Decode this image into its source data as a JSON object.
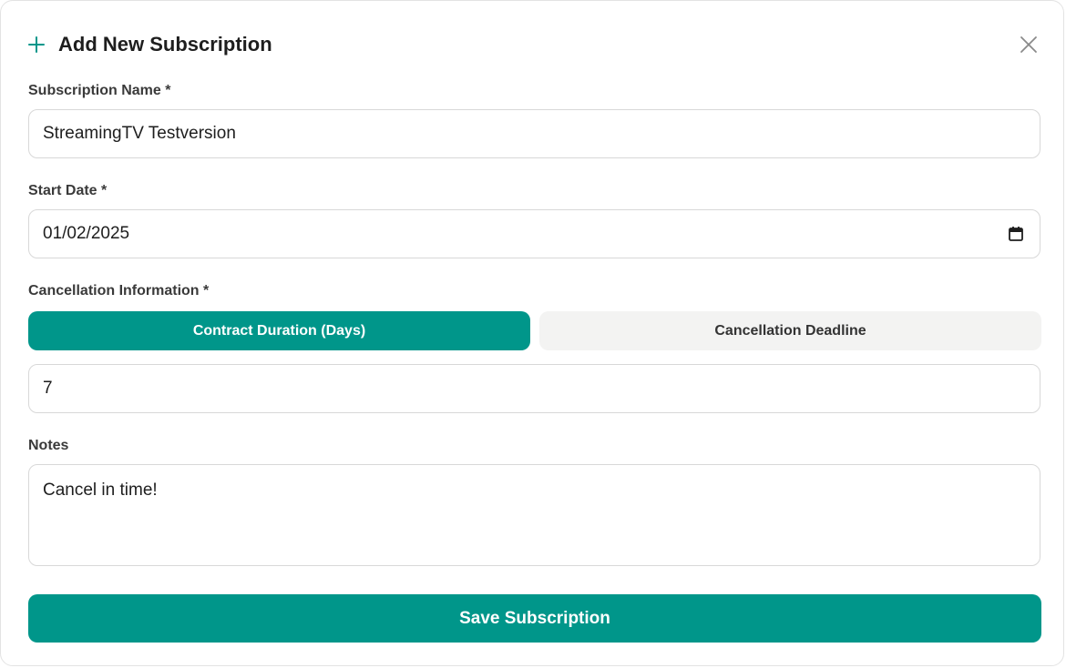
{
  "dialog": {
    "title": "Add New Subscription",
    "icons": {
      "header": "plus-icon",
      "close": "close-icon",
      "date_picker": "calendar-icon"
    }
  },
  "form": {
    "name": {
      "label": "Subscription Name *",
      "value": "StreamingTV Testversion"
    },
    "start_date": {
      "label": "Start Date *",
      "value": "01/02/2025"
    },
    "cancellation": {
      "label": "Cancellation Information *",
      "options": [
        "Contract Duration (Days)",
        "Cancellation Deadline"
      ],
      "selected": "Contract Duration (Days)",
      "value": "7"
    },
    "notes": {
      "label": "Notes",
      "value": "Cancel in time!"
    },
    "submit_label": "Save Subscription"
  },
  "colors": {
    "accent": "#00968a",
    "inactive_toggle": "#f3f3f2"
  }
}
